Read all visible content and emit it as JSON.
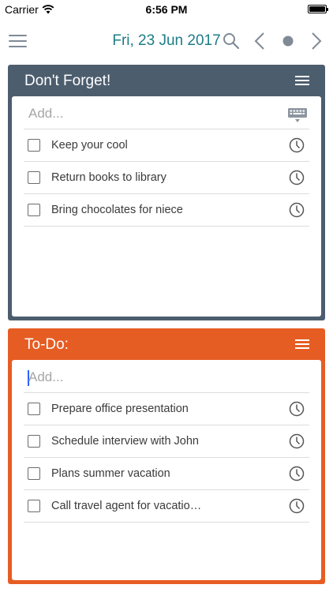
{
  "status": {
    "carrier": "Carrier",
    "time": "6:56 PM"
  },
  "nav": {
    "date": "Fri, 23 Jun 2017"
  },
  "lists": [
    {
      "title": "Don't Forget!",
      "add_placeholder": "Add...",
      "color": "#4c5d6e",
      "items": [
        "Keep your cool",
        "Return books to library",
        "Bring chocolates for niece"
      ]
    },
    {
      "title": "To-Do:",
      "add_placeholder": "Add...",
      "color": "#e65d23",
      "items": [
        "Prepare office presentation",
        "Schedule interview with John",
        "Plans summer vacation",
        "Call travel agent for vacatio…"
      ]
    }
  ],
  "colors": {
    "accent": "#1d7c86",
    "icon_gray": "#7f8a96"
  },
  "icons": [
    "wifi-icon",
    "battery-icon",
    "menu-icon",
    "search-icon",
    "chevron-left-icon",
    "today-dot-icon",
    "chevron-right-icon",
    "list-menu-icon",
    "keyboard-icon",
    "checkbox-icon",
    "clock-icon"
  ]
}
